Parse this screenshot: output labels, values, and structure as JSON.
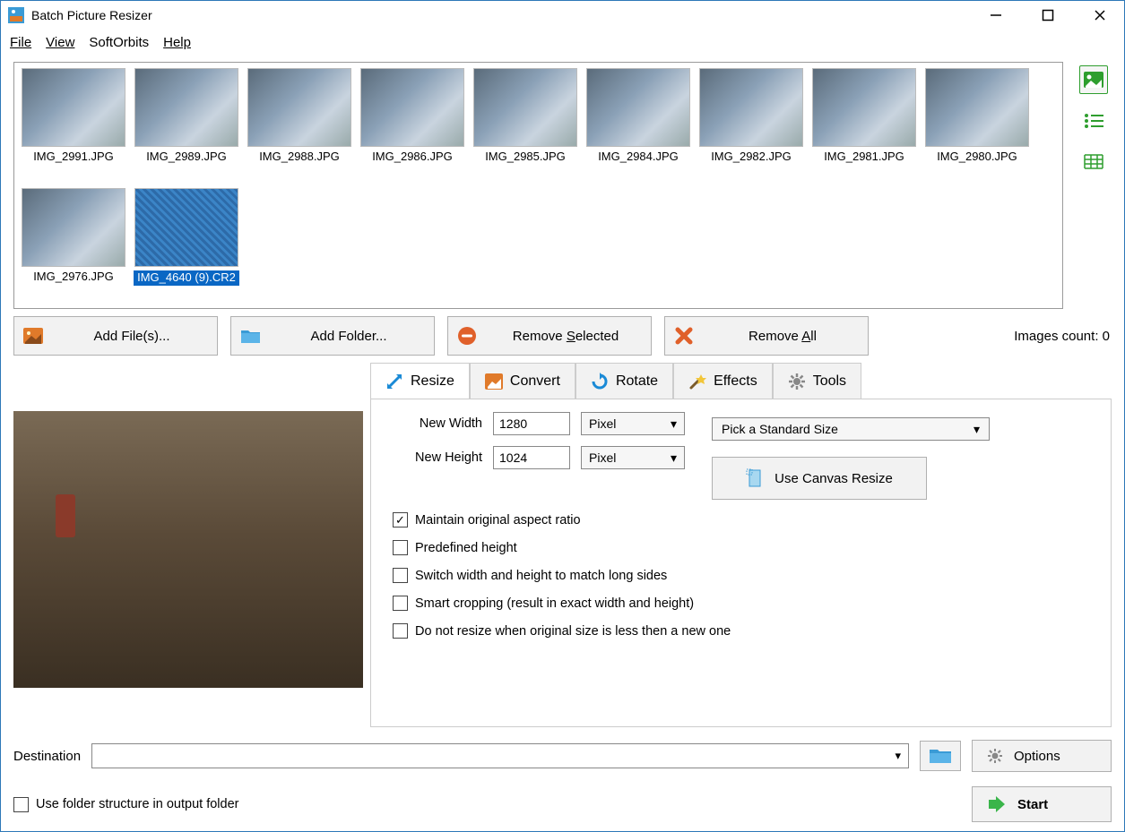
{
  "window": {
    "title": "Batch Picture Resizer"
  },
  "menu": {
    "file": "File",
    "view": "View",
    "softorbits": "SoftOrbits",
    "help": "Help"
  },
  "thumbs": [
    {
      "name": "IMG_2991.JPG"
    },
    {
      "name": "IMG_2989.JPG"
    },
    {
      "name": "IMG_2988.JPG"
    },
    {
      "name": "IMG_2986.JPG"
    },
    {
      "name": "IMG_2985.JPG"
    },
    {
      "name": "IMG_2984.JPG"
    },
    {
      "name": "IMG_2982.JPG"
    },
    {
      "name": "IMG_2981.JPG"
    },
    {
      "name": "IMG_2980.JPG"
    },
    {
      "name": "IMG_2976.JPG"
    },
    {
      "name": "IMG_4640 (9).CR2",
      "selected": true
    }
  ],
  "actions": {
    "add_files": "Add File(s)...",
    "add_folder": "Add Folder...",
    "remove_selected": "Remove Selected",
    "remove_all": "Remove All",
    "images_count_label": "Images count: 0"
  },
  "tabs": {
    "resize": "Resize",
    "convert": "Convert",
    "rotate": "Rotate",
    "effects": "Effects",
    "tools": "Tools"
  },
  "resize": {
    "new_width_label": "New Width",
    "new_height_label": "New Height",
    "width_value": "1280",
    "height_value": "1024",
    "unit": "Pixel",
    "standard_size": "Pick a Standard Size",
    "canvas_resize": "Use Canvas Resize",
    "cb_maintain": "Maintain original aspect ratio",
    "cb_predefined": "Predefined height",
    "cb_switch": "Switch width and height to match long sides",
    "cb_smartcrop": "Smart cropping (result in exact width and height)",
    "cb_donot": "Do not resize when original size is less then a new one"
  },
  "footer": {
    "destination_label": "Destination",
    "use_folder_structure": "Use folder structure in output folder",
    "options": "Options",
    "start": "Start"
  }
}
